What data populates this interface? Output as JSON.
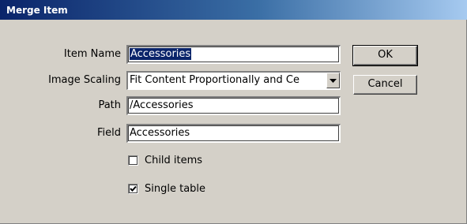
{
  "window": {
    "title": "Merge Item"
  },
  "form": {
    "item_name": {
      "label": "Item Name",
      "value": "Accessories"
    },
    "image_scaling": {
      "label": "Image Scaling",
      "value": "Fit Content Proportionally and Ce"
    },
    "path": {
      "label": "Path",
      "value": "/Accessories"
    },
    "field": {
      "label": "Field",
      "value": "Accessories"
    },
    "child_items": {
      "label": "Child items",
      "checked": false
    },
    "single_table": {
      "label": "Single table",
      "checked": true
    }
  },
  "buttons": {
    "ok": "OK",
    "cancel": "Cancel"
  },
  "icons": {
    "dropdown": "chevron-down-icon",
    "check": "check-icon"
  }
}
